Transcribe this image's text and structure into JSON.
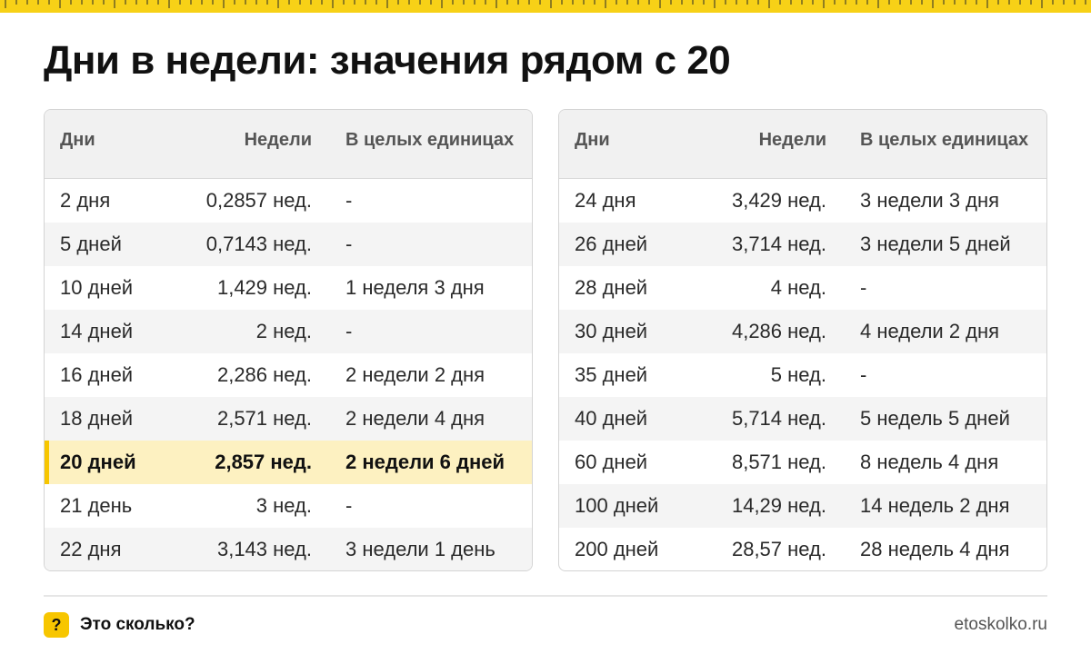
{
  "title": "Дни в недели: значения рядом с 20",
  "colors": {
    "accent": "#f7c600",
    "ruler": "#f7d117",
    "highlight_row": "#fdf1c1"
  },
  "headers": {
    "days": "Дни",
    "weeks": "Недели",
    "whole": "В целых единицах"
  },
  "left_rows": [
    {
      "days": "2 дня",
      "weeks": "0,2857 нед.",
      "whole": "-"
    },
    {
      "days": "5 дней",
      "weeks": "0,7143 нед.",
      "whole": "-"
    },
    {
      "days": "10 дней",
      "weeks": "1,429 нед.",
      "whole": "1 неделя 3 дня"
    },
    {
      "days": "14 дней",
      "weeks": "2 нед.",
      "whole": "-"
    },
    {
      "days": "16 дней",
      "weeks": "2,286 нед.",
      "whole": "2 недели 2 дня"
    },
    {
      "days": "18 дней",
      "weeks": "2,571 нед.",
      "whole": "2 недели 4 дня"
    },
    {
      "days": "20 дней",
      "weeks": "2,857 нед.",
      "whole": "2 недели 6 дней"
    },
    {
      "days": "21 день",
      "weeks": "3 нед.",
      "whole": "-"
    },
    {
      "days": "22 дня",
      "weeks": "3,143 нед.",
      "whole": "3 недели 1 день"
    }
  ],
  "right_rows": [
    {
      "days": "24 дня",
      "weeks": "3,429 нед.",
      "whole": "3 недели 3 дня"
    },
    {
      "days": "26 дней",
      "weeks": "3,714 нед.",
      "whole": "3 недели 5 дней"
    },
    {
      "days": "28 дней",
      "weeks": "4 нед.",
      "whole": "-"
    },
    {
      "days": "30 дней",
      "weeks": "4,286 нед.",
      "whole": "4 недели 2 дня"
    },
    {
      "days": "35 дней",
      "weeks": "5 нед.",
      "whole": "-"
    },
    {
      "days": "40 дней",
      "weeks": "5,714 нед.",
      "whole": "5 недель 5 дней"
    },
    {
      "days": "60 дней",
      "weeks": "8,571 нед.",
      "whole": "8 недель 4 дня"
    },
    {
      "days": "100 дней",
      "weeks": "14,29 нед.",
      "whole": "14 недель 2 дня"
    },
    {
      "days": "200 дней",
      "weeks": "28,57 нед.",
      "whole": "28 недель 4 дня"
    }
  ],
  "footer": {
    "brand_icon": "?",
    "brand_name": "Это сколько?",
    "site": "etoskolko.ru"
  }
}
